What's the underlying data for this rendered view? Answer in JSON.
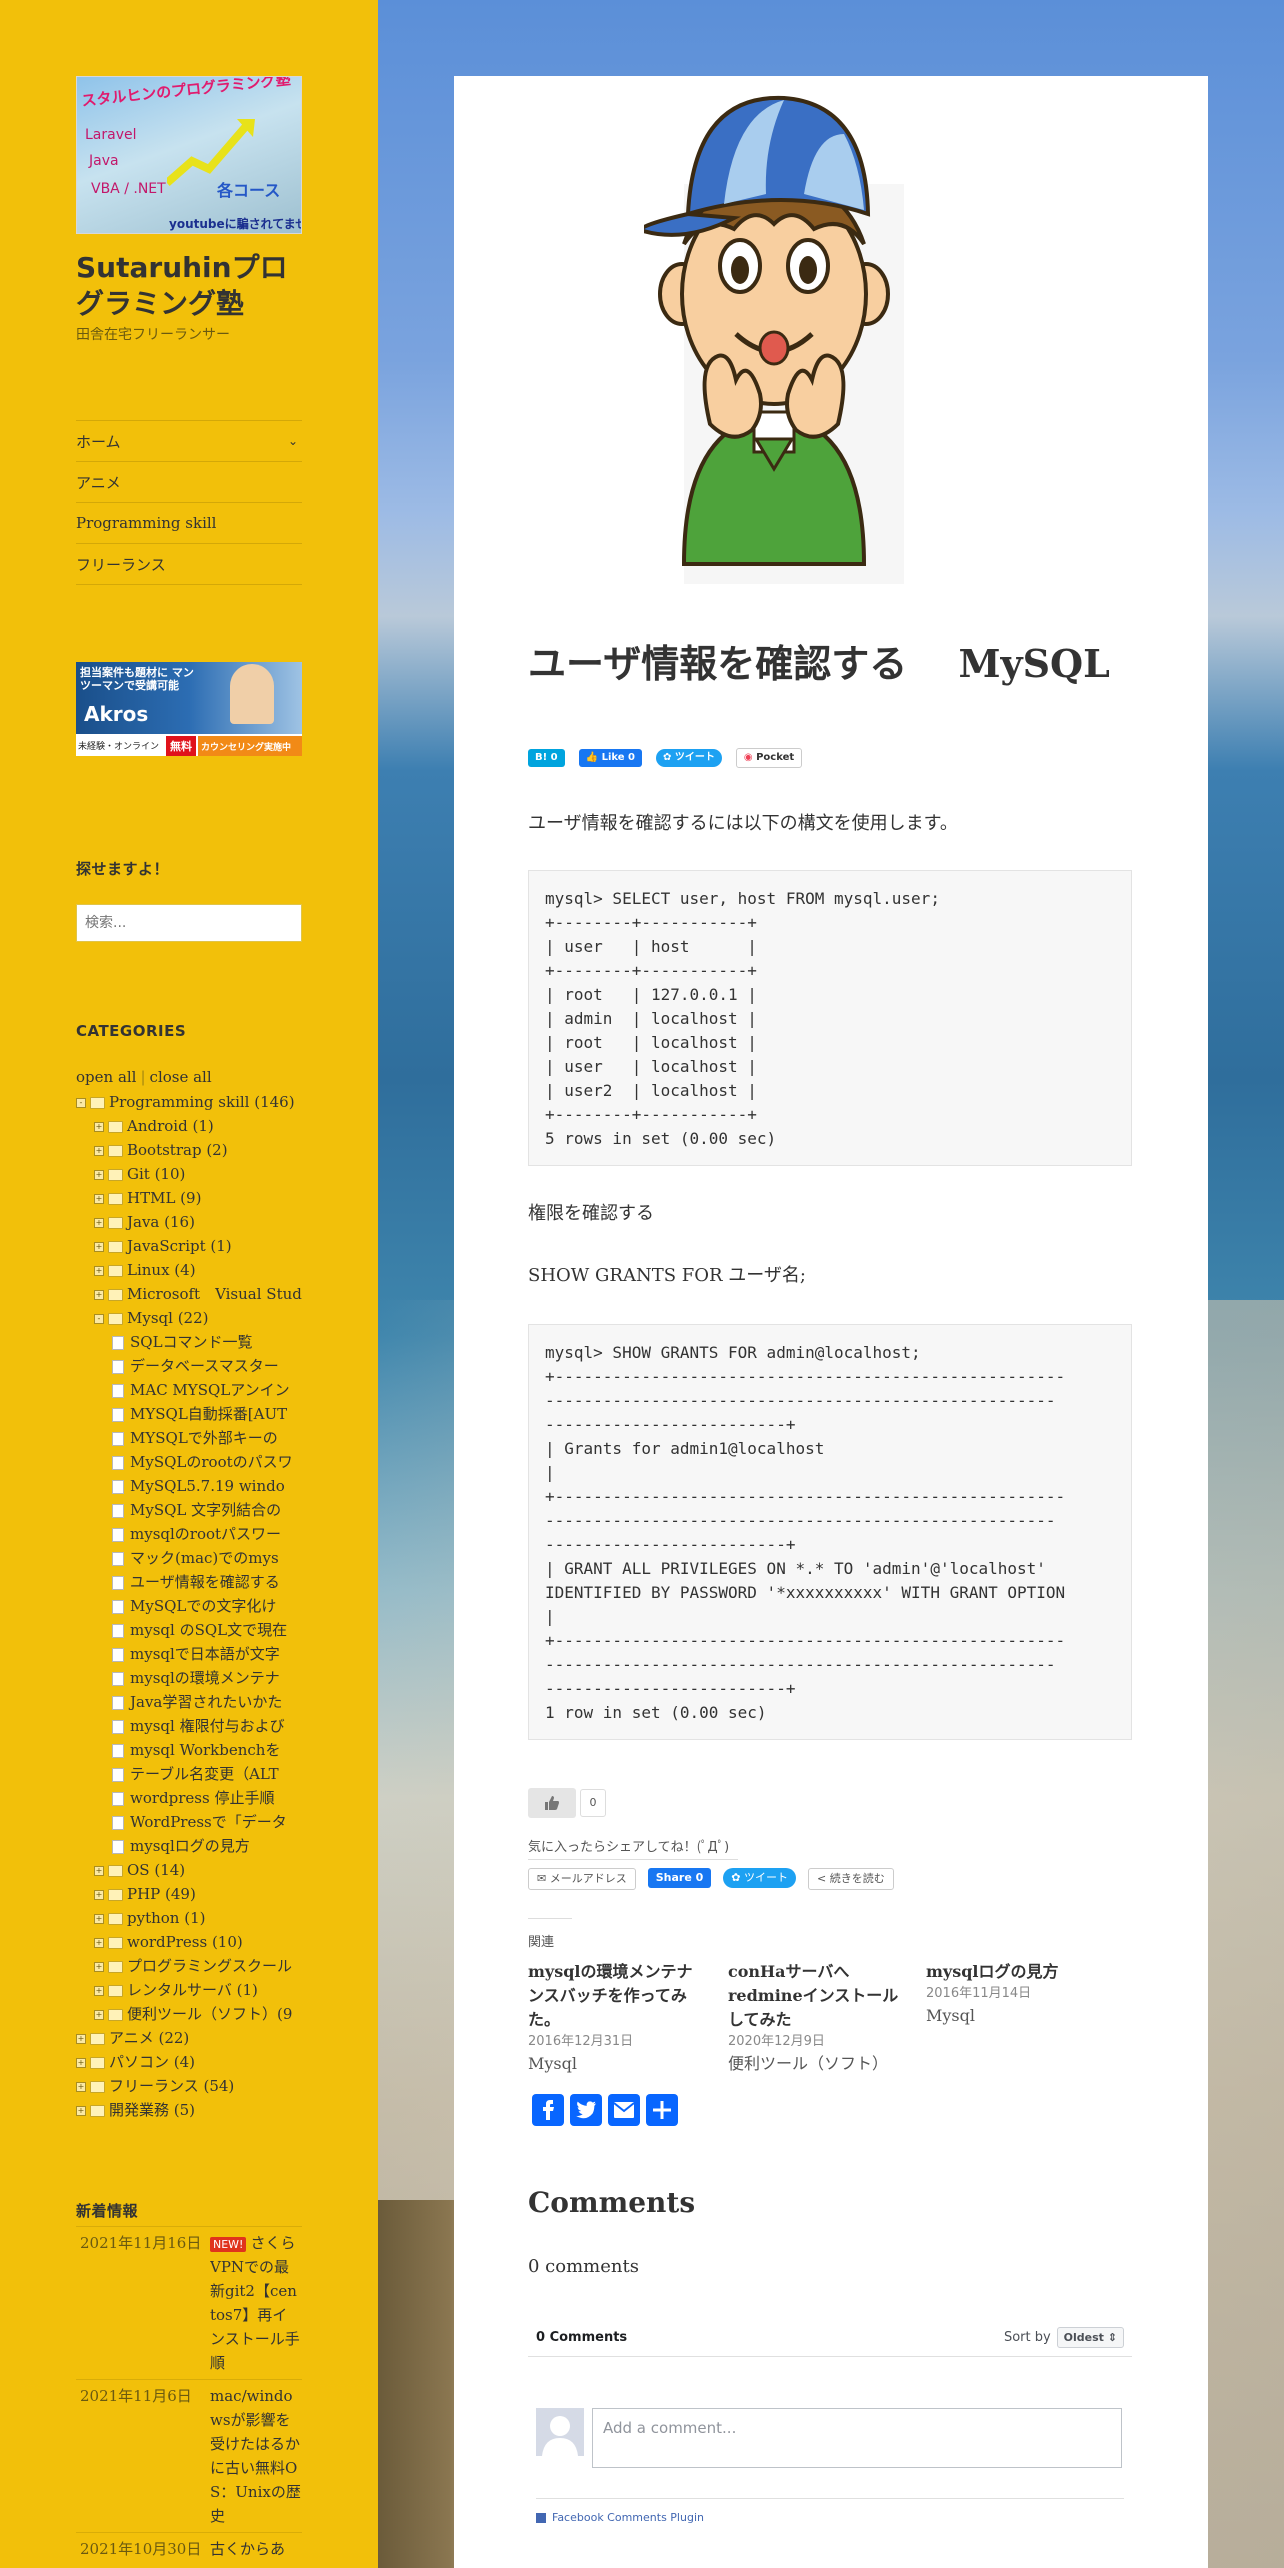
{
  "site": {
    "logo_text": [
      "スタルヒンのプログラミング塾",
      "Laravel",
      "Java",
      "VBA / .NET",
      "各コース",
      "youtubeに騙されてませんか?"
    ],
    "title": "Sutaruhinプログラミング塾",
    "description": "田舎在宅フリーランサー"
  },
  "nav": [
    {
      "label": "ホーム",
      "has_dropdown": true
    },
    {
      "label": "アニメ"
    },
    {
      "label": "Programming skill"
    },
    {
      "label": "フリーランス"
    }
  ],
  "banner": {
    "top_text": "担当案件も題材に マンツーマンで受講可能",
    "brand": "Akros",
    "bottom_left": "未経験・オンライン",
    "free": "無料",
    "counsel": "カウンセリング実施中"
  },
  "search": {
    "title": "探せますよ！",
    "placeholder": "検索..."
  },
  "categories": {
    "title": "CATEGORIES",
    "open_all": "open all",
    "sep": "|",
    "close_all": "close all",
    "tree": [
      {
        "level": 0,
        "toggle": "-",
        "type": "folder",
        "label": "Programming skill (146)"
      },
      {
        "level": 1,
        "toggle": "+",
        "type": "folder",
        "label": "Android (1)"
      },
      {
        "level": 1,
        "toggle": "+",
        "type": "folder",
        "label": "Bootstrap (2)"
      },
      {
        "level": 1,
        "toggle": "+",
        "type": "folder",
        "label": "Git (10)"
      },
      {
        "level": 1,
        "toggle": "+",
        "type": "folder",
        "label": "HTML (9)"
      },
      {
        "level": 1,
        "toggle": "+",
        "type": "folder",
        "label": "Java (16)"
      },
      {
        "level": 1,
        "toggle": "+",
        "type": "folder",
        "label": "JavaScript (1)"
      },
      {
        "level": 1,
        "toggle": "+",
        "type": "folder",
        "label": "Linux (4)"
      },
      {
        "level": 1,
        "toggle": "+",
        "type": "folder",
        "label": "Microsoft　Visual Stud"
      },
      {
        "level": 1,
        "toggle": "-",
        "type": "folder",
        "label": "Mysql (22)"
      },
      {
        "level": 2,
        "type": "file",
        "label": "SQLコマンド一覧"
      },
      {
        "level": 2,
        "type": "file",
        "label": "データベースマスター"
      },
      {
        "level": 2,
        "type": "file",
        "label": "MAC MYSQLアンイン"
      },
      {
        "level": 2,
        "type": "file",
        "label": "MYSQL自動採番[AUT"
      },
      {
        "level": 2,
        "type": "file",
        "label": "MYSQLで外部キーの"
      },
      {
        "level": 2,
        "type": "file",
        "label": "MySQLのrootのパスワ"
      },
      {
        "level": 2,
        "type": "file",
        "label": "MySQL5.7.19 windo"
      },
      {
        "level": 2,
        "type": "file",
        "label": "MySQL 文字列結合の"
      },
      {
        "level": 2,
        "type": "file",
        "label": "mysqlのrootパスワー"
      },
      {
        "level": 2,
        "type": "file",
        "label": "マック(mac)でのmys"
      },
      {
        "level": 2,
        "type": "file",
        "label": "ユーザ情報を確認する"
      },
      {
        "level": 2,
        "type": "file",
        "label": "MySQLでの文字化け"
      },
      {
        "level": 2,
        "type": "file",
        "label": "mysql のSQL文で現在"
      },
      {
        "level": 2,
        "type": "file",
        "label": "mysqlで日本語が文字"
      },
      {
        "level": 2,
        "type": "file",
        "label": "mysqlの環境メンテナ"
      },
      {
        "level": 2,
        "type": "file",
        "label": "Java学習されたいかた"
      },
      {
        "level": 2,
        "type": "file",
        "label": "mysql 権限付与および"
      },
      {
        "level": 2,
        "type": "file",
        "label": "mysql Workbenchを"
      },
      {
        "level": 2,
        "type": "file",
        "label": "テーブル名変更（ALT"
      },
      {
        "level": 2,
        "type": "file",
        "label": "wordpress 停止手順"
      },
      {
        "level": 2,
        "type": "file",
        "label": "WordPressで「データ"
      },
      {
        "level": 2,
        "type": "file",
        "label": "mysqlログの見方"
      },
      {
        "level": 1,
        "toggle": "+",
        "type": "folder",
        "label": "OS (14)"
      },
      {
        "level": 1,
        "toggle": "+",
        "type": "folder",
        "label": "PHP (49)"
      },
      {
        "level": 1,
        "toggle": "+",
        "type": "folder",
        "label": "python (1)"
      },
      {
        "level": 1,
        "toggle": "+",
        "type": "folder",
        "label": "wordPress (10)"
      },
      {
        "level": 1,
        "toggle": "+",
        "type": "folder",
        "label": "プログラミングスクール"
      },
      {
        "level": 1,
        "toggle": "+",
        "type": "folder",
        "label": "レンタルサーバ (1)"
      },
      {
        "level": 1,
        "toggle": "+",
        "type": "folder",
        "label": "便利ツール（ソフト）(9"
      },
      {
        "level": 0,
        "toggle": "+",
        "type": "folder",
        "label": "アニメ (22)"
      },
      {
        "level": 0,
        "toggle": "+",
        "type": "folder",
        "label": "パソコン (4)"
      },
      {
        "level": 0,
        "toggle": "+",
        "type": "folder",
        "label": "フリーランス (54)"
      },
      {
        "level": 0,
        "toggle": "+",
        "type": "folder",
        "label": "開発業務 (5)"
      }
    ]
  },
  "news": {
    "title": "新着情報",
    "items": [
      {
        "date": "2021年11月16日",
        "badge": "NEW!",
        "text": "さくらVPNでの最新git2【centos7】再インストール手順"
      },
      {
        "date": "2021年11月6日",
        "text": "mac/windowsが影響を受けたはるかに古い無料OS：Unixの歴史"
      },
      {
        "date": "2021年10月30日",
        "text": "古くからあ"
      }
    ]
  },
  "post": {
    "title": "ユーザ情報を確認する　 MySQL",
    "share": {
      "hatena": "B!",
      "hatena_count": "0",
      "like": "Like 0",
      "tweet": "ツイート",
      "pocket": "Pocket"
    },
    "intro": "ユーザ情報を確認するには以下の構文を使用します。",
    "code1": "mysql> SELECT user, host FROM mysql.user;\n+--------+-----------+\n| user   | host      |\n+--------+-----------+\n| root   | 127.0.0.1 |\n| admin  | localhost |\n| root   | localhost |\n| user   | localhost |\n| user2  | localhost |\n+--------+-----------+\n5 rows in set (0.00 sec)",
    "para2": "権限を確認する",
    "para3": "SHOW GRANTS FOR ユーザ名;",
    "code2": "mysql> SHOW GRANTS FOR admin@localhost;\n+-----------------------------------------------------\n-----------------------------------------------------\n-------------------------+\n| Grants for admin1@localhost\n|\n+-----------------------------------------------------\n-----------------------------------------------------\n-------------------------+\n| GRANT ALL PRIVILEGES ON *.* TO 'admin'@'localhost'\nIDENTIFIED BY PASSWORD '*xxxxxxxxxx' WITH GRANT OPTION\n|\n+-----------------------------------------------------\n-----------------------------------------------------\n-------------------------+\n1 row in set (0.00 sec)",
    "like_count": "0",
    "share_note": "気に入ったらシェアしてね！(ﾟДﾟ)",
    "share2": {
      "mail": "メールアドレス",
      "fbshare": "Share 0",
      "tweet": "ツイート",
      "more": "続きを読む"
    },
    "related_title": "関連",
    "related": [
      {
        "title": "mysqlの環境メンテナンスバッチを作ってみた。",
        "date": "2016年12月31日",
        "category": "Mysql"
      },
      {
        "title": "conHaサーバへredmineインストールしてみた",
        "date": "2020年12月9日",
        "category": "便利ツール（ソフト）"
      },
      {
        "title": "mysqlログの見方",
        "date": "2016年11月14日",
        "category": "Mysql"
      }
    ]
  },
  "comments": {
    "title": "Comments",
    "count": "0 comments",
    "fb_count": "0 Comments",
    "sort_by": "Sort by",
    "sort_value": "Oldest",
    "placeholder": "Add a comment...",
    "plugin": "Facebook Comments Plugin"
  },
  "colors": {
    "sidebar": "#f2c00a",
    "accent_fb": "#1877f2",
    "twitter": "#1da1f2",
    "hatena": "#00a4de"
  }
}
